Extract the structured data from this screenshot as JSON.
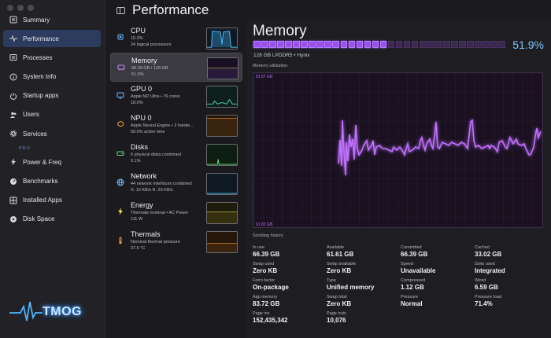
{
  "sidebar": {
    "items": [
      {
        "label": "Summary",
        "icon": "summary-icon"
      },
      {
        "label": "Performance",
        "icon": "waveform-icon",
        "active": true
      },
      {
        "label": "Processes",
        "icon": "list-icon"
      },
      {
        "label": "System Info",
        "icon": "info-icon"
      },
      {
        "label": "Startup apps",
        "icon": "power-icon"
      },
      {
        "label": "Users",
        "icon": "users-icon"
      },
      {
        "label": "Services",
        "icon": "gear-icon"
      }
    ],
    "pro_label": "PRO",
    "pro_items": [
      {
        "label": "Power & Freq",
        "icon": "bolt-icon"
      },
      {
        "label": "Benchmarks",
        "icon": "gauge-icon"
      },
      {
        "label": "Installed Apps",
        "icon": "grid-icon"
      },
      {
        "label": "Disk Space",
        "icon": "disk-icon"
      }
    ],
    "logo_text": "TMOG"
  },
  "header": {
    "title": "Performance"
  },
  "resources": [
    {
      "name": "CPU",
      "line1": "15.3%",
      "line2": "24 logical processors",
      "line3": "",
      "color": "#4fc3f7"
    },
    {
      "name": "Memory",
      "line1": "66.39 GB / 128 GB",
      "line2": "51.9%",
      "line3": "",
      "color": "#b06cff"
    },
    {
      "name": "GPU 0",
      "line1": "Apple M2 Ultra • 76 cores",
      "line2": "18.0%",
      "line3": "",
      "color": "#4fc3f7"
    },
    {
      "name": "NPU 0",
      "line1": "Apple Neural Engine • 2 hardw...",
      "line2": "50.0% active time",
      "line3": "",
      "color": "#ff9a3c"
    },
    {
      "name": "Disks",
      "line1": "6 physical disks combined",
      "line2": "0.1%",
      "line3": "",
      "color": "#66e07a"
    },
    {
      "name": "Network",
      "line1": "44 network interfaces combined",
      "line2": "S: 10 KB/s  R: 20 KB/s",
      "line3": "",
      "color": "#4fc3f7"
    },
    {
      "name": "Energy",
      "line1": "Thermals nominal • AC Power",
      "line2": "111 W",
      "line3": "",
      "color": "#f5e663"
    },
    {
      "name": "Thermals",
      "line1": "Nominal thermal pressure",
      "line2": "37.6 °C",
      "line3": "",
      "color": "#ff9a3c"
    }
  ],
  "detail": {
    "title": "Memory",
    "percent": "51.9%",
    "usage_fraction": 0.519,
    "subtitle": "128 GB LPDDR5 • Hynix",
    "graph_label": "Memory utilization",
    "graph_top": "81.57 GB",
    "graph_bottom": "61.82 GB",
    "history_label": "Scrolling history",
    "accent": "#b06cff"
  },
  "stats": [
    {
      "label": "In use",
      "value": "66.39 GB"
    },
    {
      "label": "Available",
      "value": "61.61 GB"
    },
    {
      "label": "Committed",
      "value": "66.39 GB"
    },
    {
      "label": "Cached",
      "value": "33.02 GB"
    },
    {
      "label": "Swap used",
      "value": "Zero KB"
    },
    {
      "label": "Swap available",
      "value": "Zero KB"
    },
    {
      "label": "Speed",
      "value": "Unavailable"
    },
    {
      "label": "Slots used",
      "value": "Integrated"
    },
    {
      "label": "Form factor",
      "value": "On-package"
    },
    {
      "label": "Type",
      "value": "Unified memory"
    },
    {
      "label": "Compressed",
      "value": "1.12 GB"
    },
    {
      "label": "Wired",
      "value": "6.59 GB"
    },
    {
      "label": "App memory",
      "value": "83.72 GB"
    },
    {
      "label": "Swap total",
      "value": "Zero KB"
    },
    {
      "label": "Pressure",
      "value": "Normal"
    },
    {
      "label": "Pressure load",
      "value": "71.4%"
    },
    {
      "label": "Page ins",
      "value": "152,435,342"
    },
    {
      "label": "Page outs",
      "value": "10,076"
    }
  ]
}
